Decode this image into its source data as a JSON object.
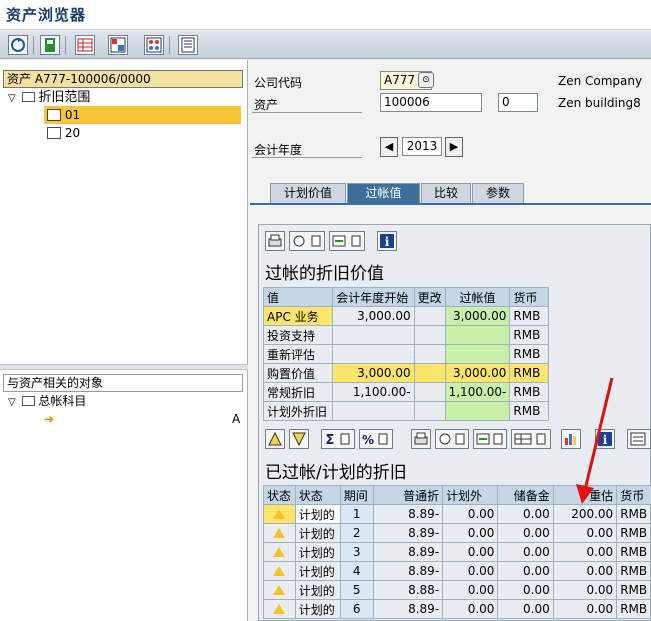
{
  "window": {
    "title": "资产浏览器"
  },
  "left": {
    "header": "资产 A777-100006/0000",
    "tree": [
      {
        "label": "折旧范围",
        "kind": "folder"
      },
      {
        "label": "01",
        "kind": "table",
        "selected": true
      },
      {
        "label": "20",
        "kind": "table",
        "selected": false
      }
    ],
    "header2": "与资产相关的对象",
    "tree2": [
      {
        "label": "总帐科目",
        "kind": "folder"
      }
    ],
    "tree2_item_code": "A"
  },
  "fields": {
    "company_code_label": "公司代码",
    "company_code_value": "A777",
    "company_name": "Zen Company",
    "asset_label": "资产",
    "asset_value": "100006",
    "asset_sub": "0",
    "asset_name": "Zen building8",
    "fiscal_year_label": "会计年度",
    "fiscal_year_value": "2013"
  },
  "tabs": [
    "计划价值",
    "过帐值",
    "比较",
    "参数"
  ],
  "active_tab": "过帐值",
  "posted_table": {
    "title": "过帐的折旧价值",
    "columns": [
      "值",
      "会计年度开始",
      "更改",
      "过帐值",
      "货币"
    ],
    "rows": [
      {
        "label": "APC 业务",
        "start": "3,000.00",
        "change": "",
        "posted": "3,000.00",
        "currency": "RMB"
      },
      {
        "label": "投资支持",
        "start": "",
        "change": "",
        "posted": "",
        "currency": "RMB"
      },
      {
        "label": "重新评估",
        "start": "",
        "change": "",
        "posted": "",
        "currency": "RMB"
      },
      {
        "label": "购置价值",
        "start": "3,000.00",
        "change": "",
        "posted": "3,000.00",
        "currency": "RMB"
      },
      {
        "label": "常规折旧",
        "start": "1,100.00-",
        "change": "",
        "posted": "1,100.00-",
        "currency": "RMB"
      },
      {
        "label": "计划外折旧",
        "start": "",
        "change": "",
        "posted": "",
        "currency": "RMB"
      }
    ]
  },
  "planned_table": {
    "title": "已过帐/计划的折旧",
    "columns": [
      "状态",
      "状态",
      "期间",
      "普通折",
      "计划外",
      "储备金",
      "重估",
      "货币"
    ],
    "rows": [
      {
        "status": "计划的",
        "period": "1",
        "ordinary": "8.89-",
        "unplanned": "0.00",
        "reserve": "0.00",
        "revaluation": "200.00",
        "currency": "RMB"
      },
      {
        "status": "计划的",
        "period": "2",
        "ordinary": "8.89-",
        "unplanned": "0.00",
        "reserve": "0.00",
        "revaluation": "0.00",
        "currency": "RMB"
      },
      {
        "status": "计划的",
        "period": "3",
        "ordinary": "8.89-",
        "unplanned": "0.00",
        "reserve": "0.00",
        "revaluation": "0.00",
        "currency": "RMB"
      },
      {
        "status": "计划的",
        "period": "4",
        "ordinary": "8.89-",
        "unplanned": "0.00",
        "reserve": "0.00",
        "revaluation": "0.00",
        "currency": "RMB"
      },
      {
        "status": "计划的",
        "period": "5",
        "ordinary": "8.88-",
        "unplanned": "0.00",
        "reserve": "0.00",
        "revaluation": "0.00",
        "currency": "RMB"
      },
      {
        "status": "计划的",
        "period": "6",
        "ordinary": "8.89-",
        "unplanned": "0.00",
        "reserve": "0.00",
        "revaluation": "0.00",
        "currency": "RMB"
      }
    ]
  },
  "colors": {
    "selected": "#f8c43a",
    "active_tab": "#3d6f9a",
    "yellow_cell": "#fbe56b",
    "green_cell": "#c9f0a8",
    "annotation": "#e01010"
  }
}
